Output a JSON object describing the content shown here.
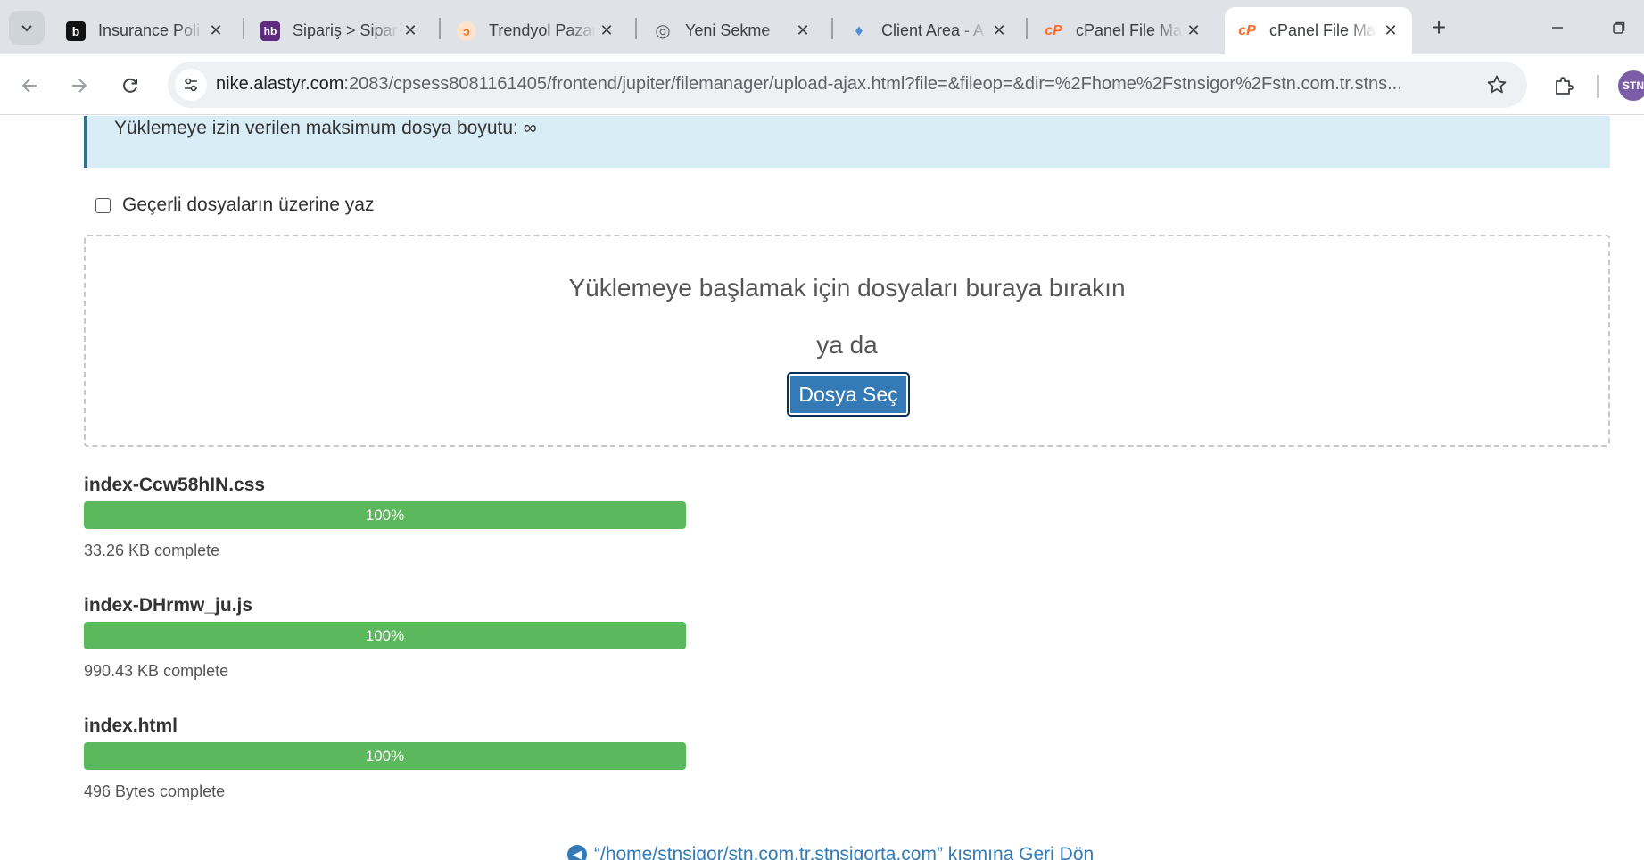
{
  "browser": {
    "tabs": [
      {
        "label": "Insurance Poli",
        "favicon": "b-logo-icon",
        "color": "#111111",
        "text": "b"
      },
      {
        "label": "Sipariş > Sipar",
        "favicon": "hb-logo-icon",
        "color": "#5e2b7e",
        "text": "hb"
      },
      {
        "label": "Trendyol Pazar",
        "favicon": "trendyol-icon",
        "color": "#f27a1a",
        "text": "ↄ"
      },
      {
        "label": "Yeni Sekme",
        "favicon": "chrome-icon",
        "color": "#5f6368",
        "text": "◎"
      },
      {
        "label": "Client Area - A",
        "favicon": "rocket-icon",
        "color": "#4a90d9",
        "text": "♦"
      },
      {
        "label": "cPanel File Ma",
        "favicon": "cpanel-icon",
        "color": "#ff6c2c",
        "text": "cP"
      },
      {
        "label": "cPanel File Ma",
        "favicon": "cpanel-icon",
        "color": "#ff6c2c",
        "text": "cP"
      }
    ],
    "active_tab_index": 6,
    "url_host": "nike.alastyr.com",
    "url_rest": ":2083/cpsess8081161405/frontend/jupiter/filemanager/upload-ajax.html?file=&fileop=&dir=%2Fhome%2Fstnsigor%2Fstn.com.tr.stns...",
    "profile_initials": "STN"
  },
  "page": {
    "max_size_text": "Yüklemeye izin verilen maksimum dosya boyutu: ∞",
    "overwrite_label": "Geçerli dosyaların üzerine yaz",
    "overwrite_checked": false,
    "drop_title": "Yüklemeye başlamak için dosyaları buraya bırakın",
    "drop_or": "ya da",
    "choose_button": "Dosya Seç",
    "files": [
      {
        "name": "index-Ccw58hIN.css",
        "progress": 100,
        "progress_label": "100%",
        "status": "33.26 KB complete"
      },
      {
        "name": "index-DHrmw_ju.js",
        "progress": 100,
        "progress_label": "100%",
        "status": "990.43 KB complete"
      },
      {
        "name": "index.html",
        "progress": 100,
        "progress_label": "100%",
        "status": "496 Bytes complete"
      }
    ],
    "back_link": "“/home/stnsigor/stn.com.tr.stnsigorta.com” kısmına Geri Dön"
  },
  "colors": {
    "primary": "#337ab7",
    "success": "#5cb85c",
    "info_bg": "#d9edf7",
    "info_border": "#31708f"
  }
}
